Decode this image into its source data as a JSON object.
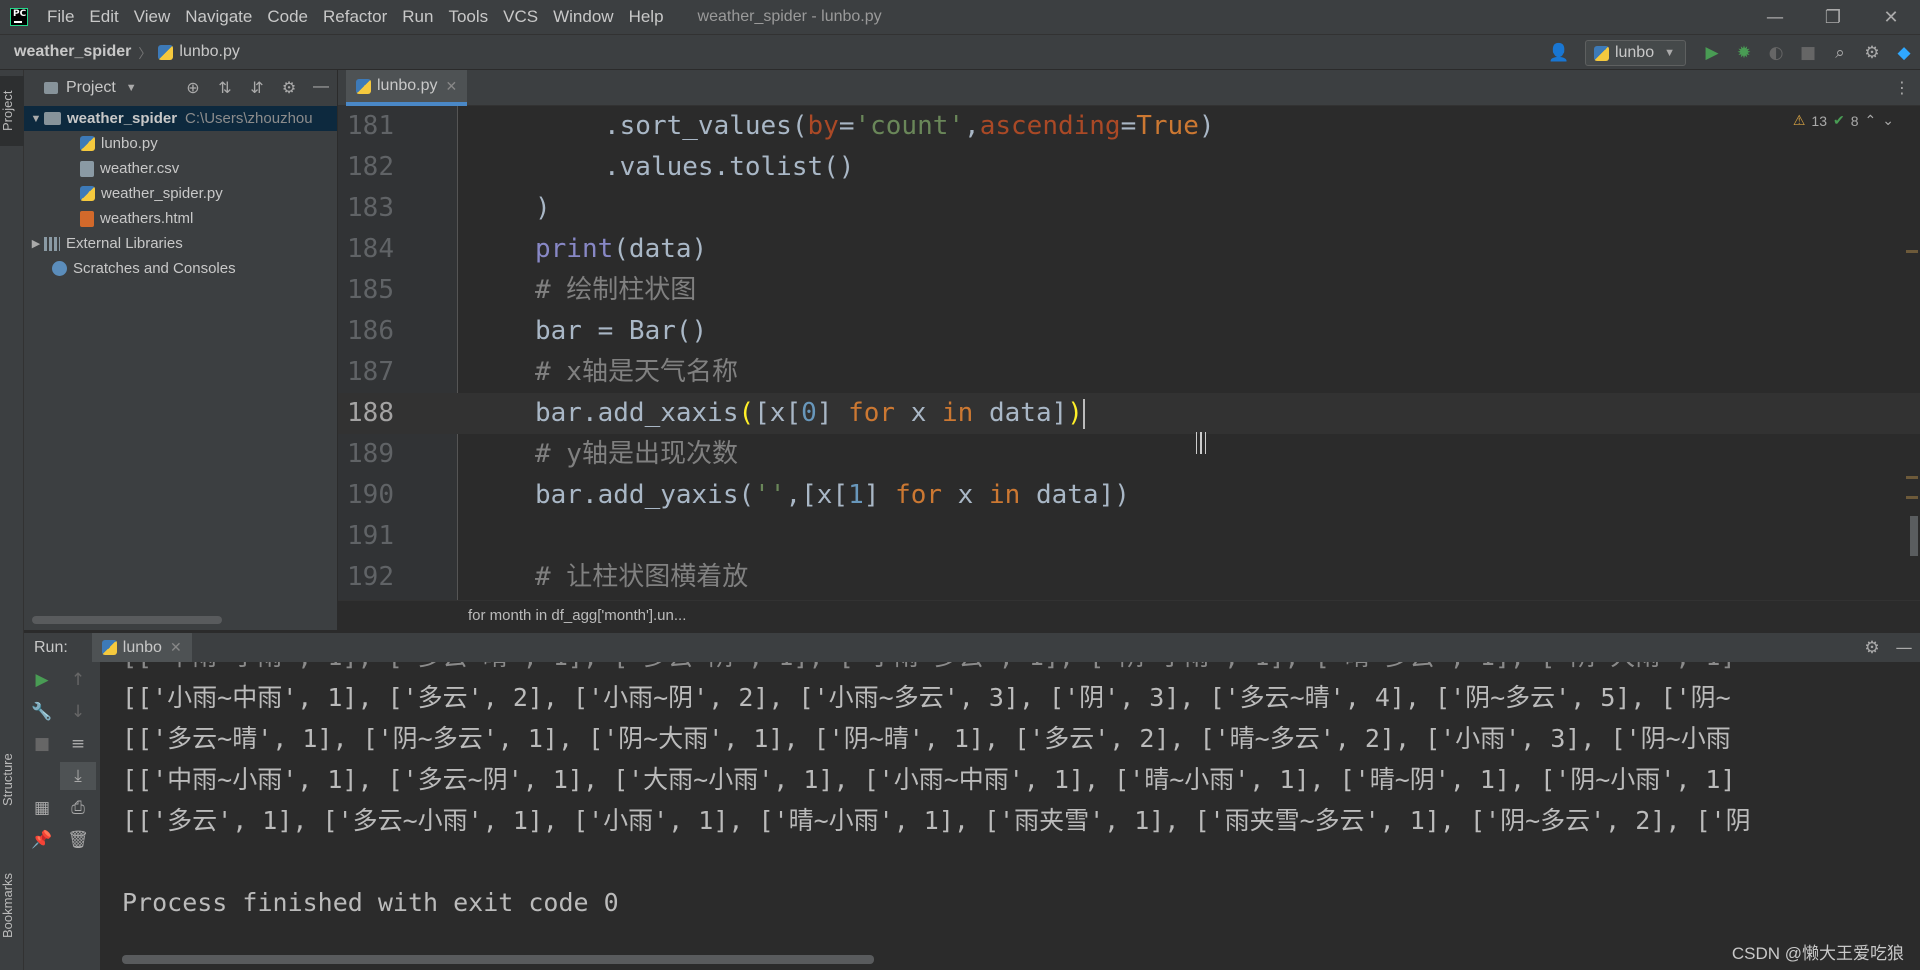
{
  "titlebar": {
    "menu": [
      "File",
      "Edit",
      "View",
      "Navigate",
      "Code",
      "Refactor",
      "Run",
      "Tools",
      "VCS",
      "Window",
      "Help"
    ],
    "title": "weather_spider - lunbo.py",
    "controls": [
      "—",
      "❐",
      "✕"
    ]
  },
  "navbar": {
    "project": "weather_spider",
    "file": "lunbo.py",
    "run_config": "lunbo"
  },
  "left_strip": {
    "project_tab": "Project",
    "structure_tab": "Structure",
    "bookmarks_tab": "Bookmarks"
  },
  "project_panel": {
    "title": "Project",
    "root": "weather_spider",
    "root_path": "C:\\Users\\zhouzhou",
    "files": [
      "lunbo.py",
      "weather.csv",
      "weather_spider.py",
      "weathers.html"
    ],
    "external": "External Libraries",
    "scratches": "Scratches and Consoles"
  },
  "editor": {
    "tab": "lunbo.py",
    "warnings": "13",
    "ok": "8",
    "current_line": 188,
    "line_numbers": [
      "181",
      "182",
      "183",
      "184",
      "185",
      "186",
      "187",
      "188",
      "189",
      "190",
      "191",
      "192"
    ],
    "breadcrumb": "for month in df_agg['month'].un..."
  },
  "run_panel": {
    "label": "Run:",
    "tab": "lunbo",
    "output": [
      "[['小雨~中雨', 1], ['多云', 2], ['小雨~阴', 2], ['小雨~多云', 3], ['阴', 3], ['多云~晴', 4], ['阴~多云', 5], ['阴~",
      "[['多云~晴', 1], ['阴~多云', 1], ['阴~大雨', 1], ['阴~晴', 1], ['多云', 2], ['晴~多云', 2], ['小雨', 3], ['阴~小雨",
      "[['中雨~小雨', 1], ['多云~阴', 1], ['大雨~小雨', 1], ['小雨~中雨', 1], ['晴~小雨', 1], ['晴~阴', 1], ['阴~小雨', 1]",
      "[['多云', 1], ['多云~小雨', 1], ['小雨', 1], ['晴~小雨', 1], ['雨夹雪', 1], ['雨夹雪~多云', 1], ['阴~多云', 2], ['阴"
    ],
    "finished": "Process finished with exit code 0"
  },
  "watermark": "CSDN @懒大王爱吃狼"
}
